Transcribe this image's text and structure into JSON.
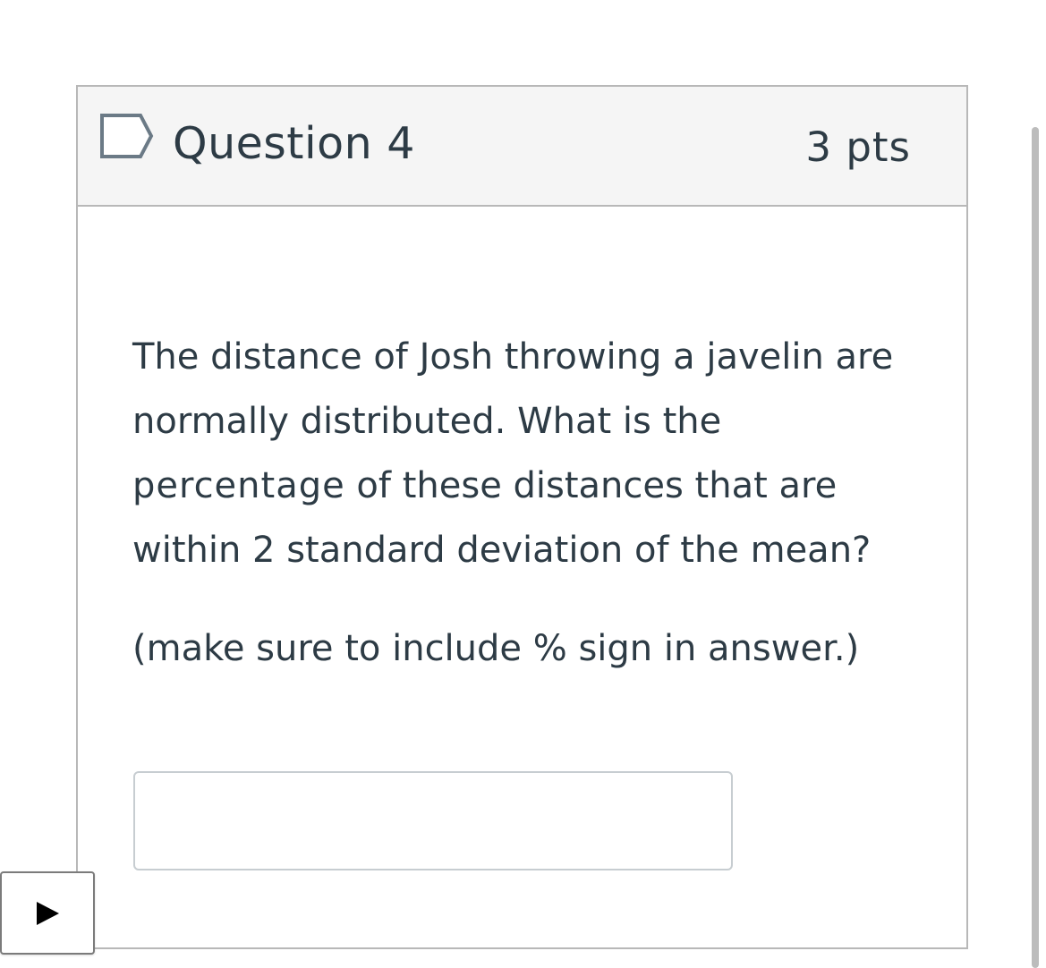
{
  "question": {
    "title": "Question 4",
    "points": "3 pts",
    "text_line1": "The distance of Josh throwing a javelin are",
    "text_line2": "normally distributed.  What is the",
    "text_emphasis": "percentage",
    "text_line3_rest": " of these distances that are",
    "text_line4": "within 2 standard deviation of the mean?",
    "note": "(make sure to include % sign in answer.)",
    "answer": {
      "value": "",
      "placeholder": ""
    }
  },
  "icons": {
    "flag": "flag-icon",
    "play": "play-icon"
  },
  "colors": {
    "text": "#2d3b45",
    "header_bg": "#f5f5f5",
    "border": "#b8b8b8",
    "flag": "#6b7a86"
  }
}
